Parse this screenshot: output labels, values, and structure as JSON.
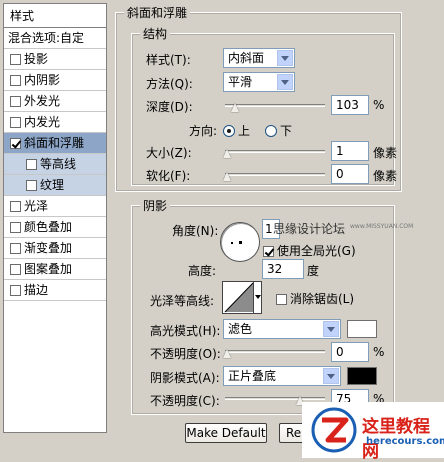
{
  "style_list": {
    "header": "样式",
    "blend_options": "混合选项:自定",
    "items": [
      {
        "label": "投影",
        "checked": false
      },
      {
        "label": "内阴影",
        "checked": false
      },
      {
        "label": "外发光",
        "checked": false
      },
      {
        "label": "内发光",
        "checked": false
      },
      {
        "label": "斜面和浮雕",
        "checked": true,
        "selected": true
      },
      {
        "label": "等高线",
        "checked": false,
        "sub": true
      },
      {
        "label": "纹理",
        "checked": false,
        "sub": true
      },
      {
        "label": "光泽",
        "checked": false
      },
      {
        "label": "颜色叠加",
        "checked": false
      },
      {
        "label": "渐变叠加",
        "checked": false
      },
      {
        "label": "图案叠加",
        "checked": false
      },
      {
        "label": "描边",
        "checked": false
      }
    ]
  },
  "bevel": {
    "group_title": "斜面和浮雕",
    "structure_title": "结构",
    "style_label": "样式(T):",
    "style_value": "内斜面",
    "technique_label": "方法(Q):",
    "technique_value": "平滑",
    "depth_label": "深度(D):",
    "depth_value": "103",
    "depth_unit": "%",
    "depth_fraction": 0.1,
    "direction_label": "方向:",
    "direction_up": "上",
    "direction_down": "下",
    "size_label": "大小(Z):",
    "size_value": "1",
    "size_unit": "像素",
    "soften_label": "软化(F):",
    "soften_value": "0",
    "soften_unit": "像素"
  },
  "shading": {
    "title": "阴影",
    "angle_label": "角度(N):",
    "angle_value": "1度",
    "overlay_text": "思缘设计论坛",
    "overlay_url": "www.MISSYUAN.COM",
    "global_light_label": "使用全局光(G)",
    "global_light_checked": true,
    "altitude_label": "高度:",
    "altitude_value": "32",
    "altitude_unit": "度",
    "gloss_label": "光泽等高线:",
    "antialias_label": "消除锯齿(L)",
    "highlight_mode_label": "高光模式(H):",
    "highlight_mode_value": "滤色",
    "highlight_color": "#ffffff",
    "highlight_opacity_label": "不透明度(O):",
    "highlight_opacity_value": "0",
    "highlight_opacity_unit": "%",
    "shadow_mode_label": "阴影模式(A):",
    "shadow_mode_value": "正片叠底",
    "shadow_color": "#000000",
    "shadow_opacity_label": "不透明度(C):",
    "shadow_opacity_value": "75",
    "shadow_opacity_unit": "%",
    "shadow_opacity_fraction": 0.75
  },
  "buttons": {
    "make_default": "Make Default",
    "reset": "Re"
  },
  "watermark": {
    "title": "这里教程网",
    "url": "herecours.com"
  },
  "colors": {
    "selected_row": "#8da5c6",
    "sub_row": "#c6d3e5",
    "watermark_red": "#d9231a",
    "watermark_blue": "#1a5fb4"
  }
}
